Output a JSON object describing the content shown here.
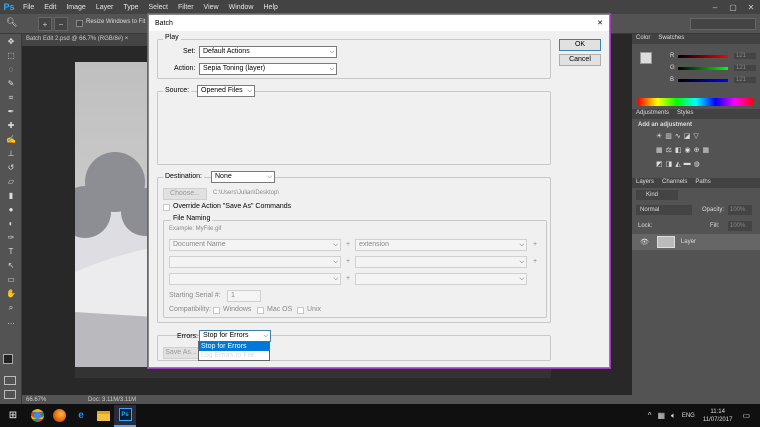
{
  "app": {
    "logo": "Ps",
    "menu": [
      "File",
      "Edit",
      "Image",
      "Layer",
      "Type",
      "Select",
      "Filter",
      "View",
      "Window",
      "Help"
    ],
    "window_controls": [
      "–",
      "▢",
      "✕"
    ],
    "options": {
      "resize_label": "Resize Windows to Fit"
    },
    "workspace": "Essentials",
    "doc_tab": "Batch Edit 2.psd @ 66.7% (RGB/8#) ×",
    "zoom": "66.67%",
    "doc_size": "Doc: 3.11M/3.11M"
  },
  "panels": {
    "color_tabs": [
      "Color",
      "Swatches"
    ],
    "rgb": [
      {
        "ch": "R",
        "val": "121"
      },
      {
        "ch": "G",
        "val": "121"
      },
      {
        "ch": "B",
        "val": "121"
      }
    ],
    "adjust_tabs": [
      "Adjustments",
      "Styles"
    ],
    "adjust_label": "Add an adjustment",
    "layer_tabs": [
      "Layers",
      "Channels",
      "Paths"
    ],
    "kind": "Kind",
    "blend": "Normal",
    "opacity_label": "Opacity:",
    "opacity": "100%",
    "lock_label": "Lock:",
    "fill_label": "Fill:",
    "fill": "100%",
    "layer_name": "Layer"
  },
  "dialog": {
    "title": "Batch",
    "close": "✕",
    "ok": "OK",
    "cancel": "Cancel",
    "play": {
      "legend": "Play",
      "set_label": "Set:",
      "set_value": "Default Actions",
      "action_label": "Action:",
      "action_value": "Sepia Toning (layer)"
    },
    "source": {
      "label": "Source:",
      "value": "Opened Files"
    },
    "destination": {
      "label": "Destination:",
      "value": "None",
      "choose": "Choose...",
      "path": "C:\\Users\\Julian\\Desktop\\",
      "override": "Override Action \"Save As\" Commands"
    },
    "naming": {
      "legend": "File Naming",
      "example": "Example: MyFile.gif",
      "field1": "Document Name",
      "field2": "extension",
      "plus": "+",
      "serial_label": "Starting Serial #:",
      "serial": "1",
      "compat_label": "Compatibility:",
      "windows": "Windows",
      "mac": "Mac OS",
      "unix": "Unix"
    },
    "errors": {
      "label": "Errors:",
      "value": "Stop for Errors",
      "saveas": "Save As...",
      "options": [
        "Stop for Errors",
        "Log Errors to File"
      ]
    }
  },
  "taskbar": {
    "time": "11:14",
    "date": "11/07/2017",
    "lang": "ENG"
  }
}
